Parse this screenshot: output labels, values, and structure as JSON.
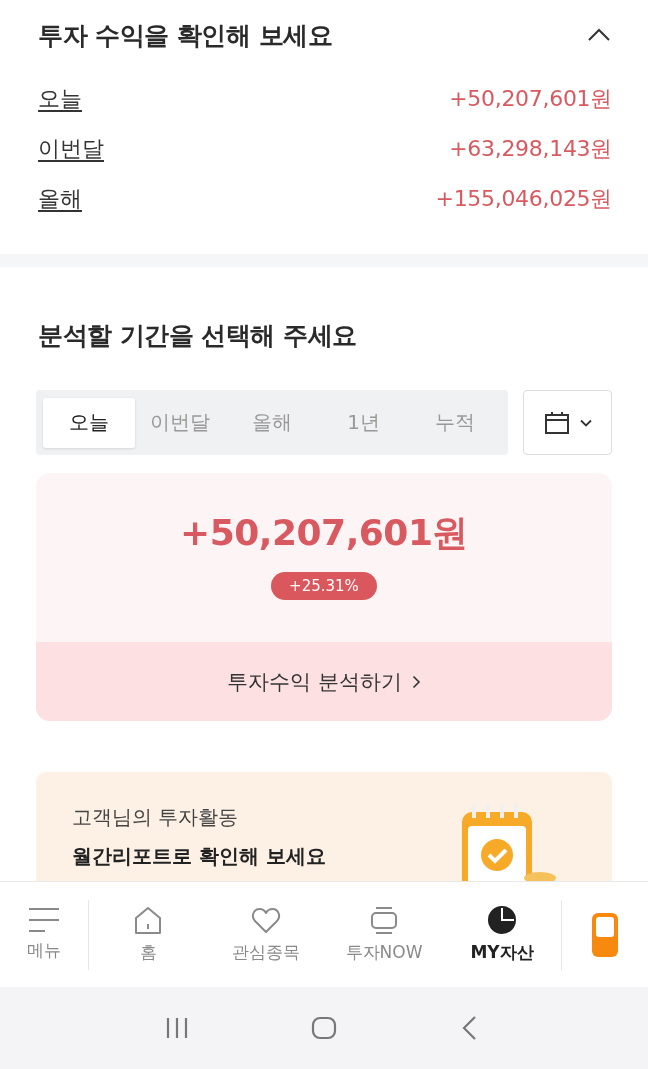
{
  "summary": {
    "title": "투자 수익을 확인해 보세요",
    "expanded": true,
    "rows": [
      {
        "label": "오늘",
        "value": "+50,207,601원"
      },
      {
        "label": "이번달",
        "value": "+63,298,143원"
      },
      {
        "label": "올해",
        "value": "+155,046,025원"
      }
    ]
  },
  "period": {
    "title": "분석할 기간을 선택해 주세요",
    "tabs": [
      {
        "label": "오늘",
        "selected": true
      },
      {
        "label": "이번달",
        "selected": false
      },
      {
        "label": "올해",
        "selected": false
      },
      {
        "label": "1년",
        "selected": false
      },
      {
        "label": "누적",
        "selected": false
      }
    ],
    "amount": "+50,207,601원",
    "rate": "+25.31%",
    "analyze_link": "투자수익 분석하기"
  },
  "banner": {
    "line_1": "고객님의 투자활동",
    "line_2": "월간리포트로 확인해 보세요"
  },
  "bottom_nav": {
    "menu_label": "메뉴",
    "items": [
      {
        "kind": "home",
        "label": "홈",
        "selected": false
      },
      {
        "kind": "heart",
        "label": "관심종목",
        "selected": false
      },
      {
        "kind": "cards",
        "label": "투자NOW",
        "selected": false
      },
      {
        "kind": "pie",
        "label": "MY자산",
        "selected": true
      }
    ]
  }
}
